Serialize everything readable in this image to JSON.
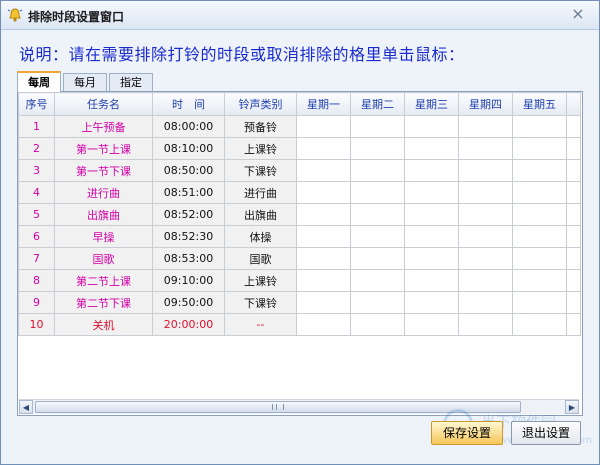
{
  "window": {
    "title": "排除时段设置窗口",
    "close_glyph": "×"
  },
  "instruction": "说明：请在需要排除打铃的时段或取消排除的格里单击鼠标：",
  "tabs": [
    {
      "label": "每周",
      "active": true
    },
    {
      "label": "每月",
      "active": false
    },
    {
      "label": "指定",
      "active": false
    }
  ],
  "grid": {
    "columns": [
      "序号",
      "任务名",
      "时　间",
      "铃声类别",
      "星期一",
      "星期二",
      "星期三",
      "星期四",
      "星期五"
    ],
    "rows": [
      [
        "1",
        "上午预备",
        "08:00:00",
        "预备铃"
      ],
      [
        "2",
        "第一节上课",
        "08:10:00",
        "上课铃"
      ],
      [
        "3",
        "第一节下课",
        "08:50:00",
        "下课铃"
      ],
      [
        "4",
        "进行曲",
        "08:51:00",
        "进行曲"
      ],
      [
        "5",
        "出旗曲",
        "08:52:00",
        "出旗曲"
      ],
      [
        "6",
        "早操",
        "08:52:30",
        "体操"
      ],
      [
        "7",
        "国歌",
        "08:53:00",
        "国歌"
      ],
      [
        "8",
        "第二节上课",
        "09:10:00",
        "上课铃"
      ],
      [
        "9",
        "第二节下课",
        "09:50:00",
        "下课铃"
      ],
      [
        "10",
        "关机",
        "20:00:00",
        "--"
      ]
    ]
  },
  "scrollbar": {
    "left_glyph": "◀",
    "right_glyph": "▶"
  },
  "buttons": {
    "save": "保存设置",
    "exit": "退出设置"
  },
  "watermark": {
    "text": "当下软件园",
    "url": "www.downxia.com"
  },
  "colors": {
    "instruction": "#1a2bd0",
    "task_name": "#d400a8",
    "last_row": "#e0102e",
    "tab_accent": "#f0a43a"
  }
}
